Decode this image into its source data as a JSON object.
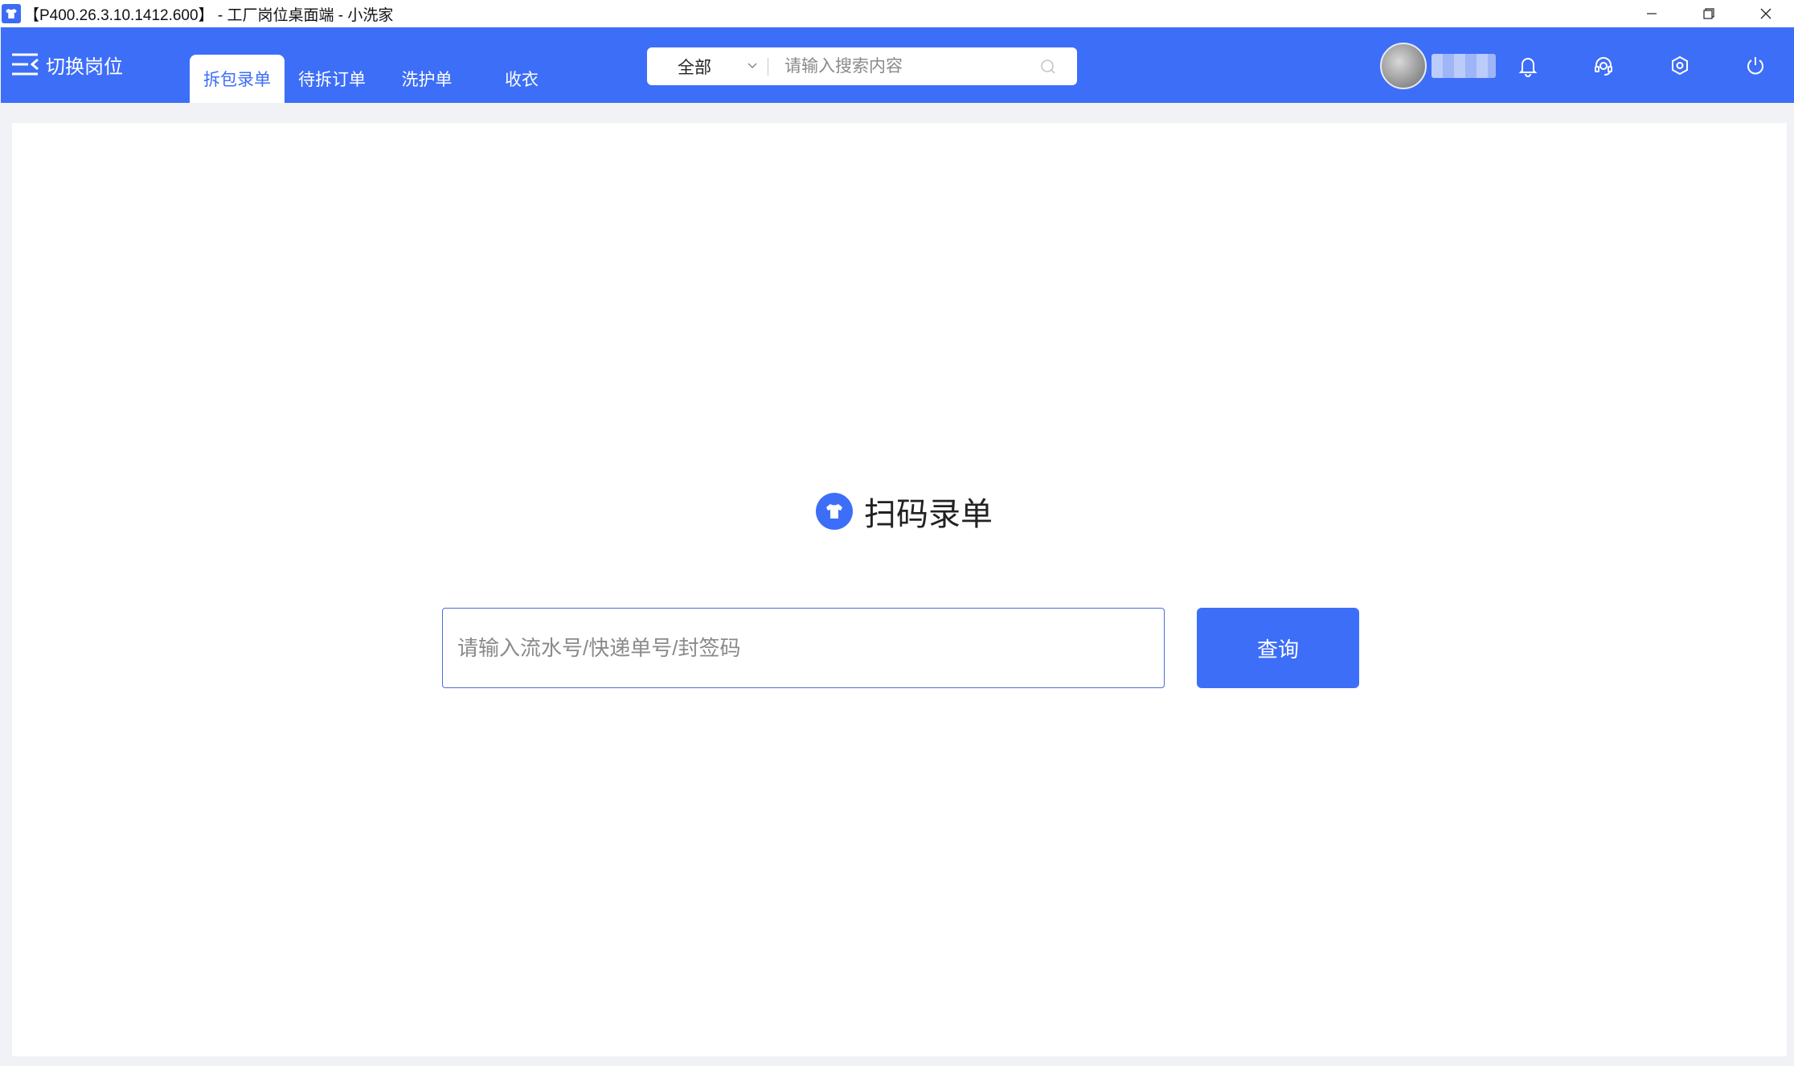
{
  "window": {
    "title": "【P400.26.3.10.1412.600】 - 工厂岗位桌面端 - 小洗家",
    "app_icon": "t-shirt-icon"
  },
  "header": {
    "switch_post_label": "切换岗位",
    "tabs": [
      {
        "label": "拆包录单",
        "active": true
      },
      {
        "label": "待拆订单",
        "active": false
      },
      {
        "label": "洗护单",
        "active": false
      },
      {
        "label": "收衣",
        "active": false
      }
    ],
    "search": {
      "scope": "全部",
      "placeholder": "请输入搜索内容"
    },
    "icons": [
      "bell-icon",
      "headset-icon",
      "settings-icon",
      "power-icon"
    ]
  },
  "main": {
    "title": "扫码录单",
    "input_placeholder": "请输入流水号/快递单号/封签码",
    "query_label": "查询"
  },
  "colors": {
    "accent": "#3d6ef7",
    "background": "#f0f2f5"
  }
}
